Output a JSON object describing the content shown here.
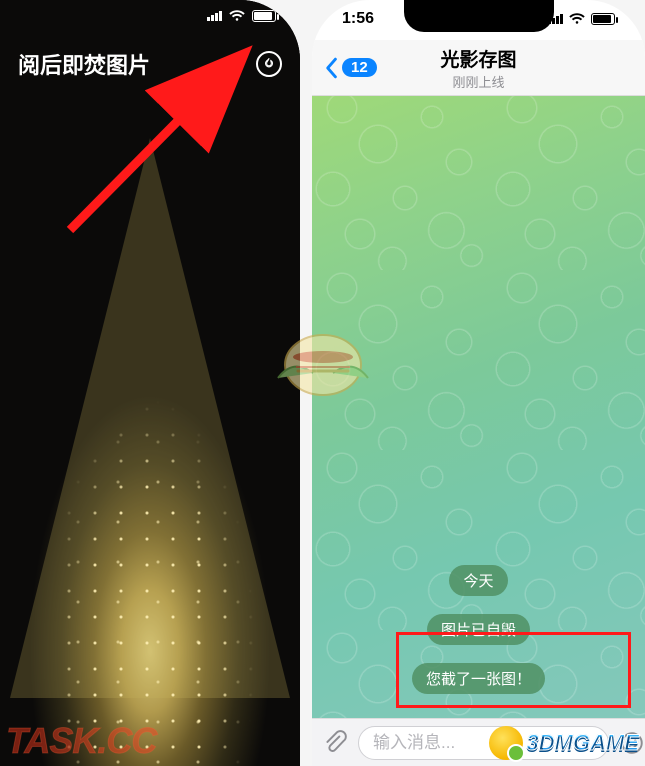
{
  "left_phone": {
    "header_title": "阅后即焚图片",
    "timer_icon_name": "self-destruct-timer-icon"
  },
  "right_phone": {
    "status": {
      "time": "1:56"
    },
    "back_badge": "12",
    "chat_title": "光影存图",
    "chat_subtitle": "刚刚上线",
    "date_pill": "今天",
    "system_messages": [
      "图片已自毁",
      "您截了一张图！"
    ],
    "input_placeholder": "输入消息..."
  },
  "watermarks": {
    "left_text": "TASK.CC",
    "right_text": "3DMGAME"
  },
  "annotations": {
    "arrow_target": "self-destruct-timer-icon",
    "highlight_target": "system-messages"
  }
}
